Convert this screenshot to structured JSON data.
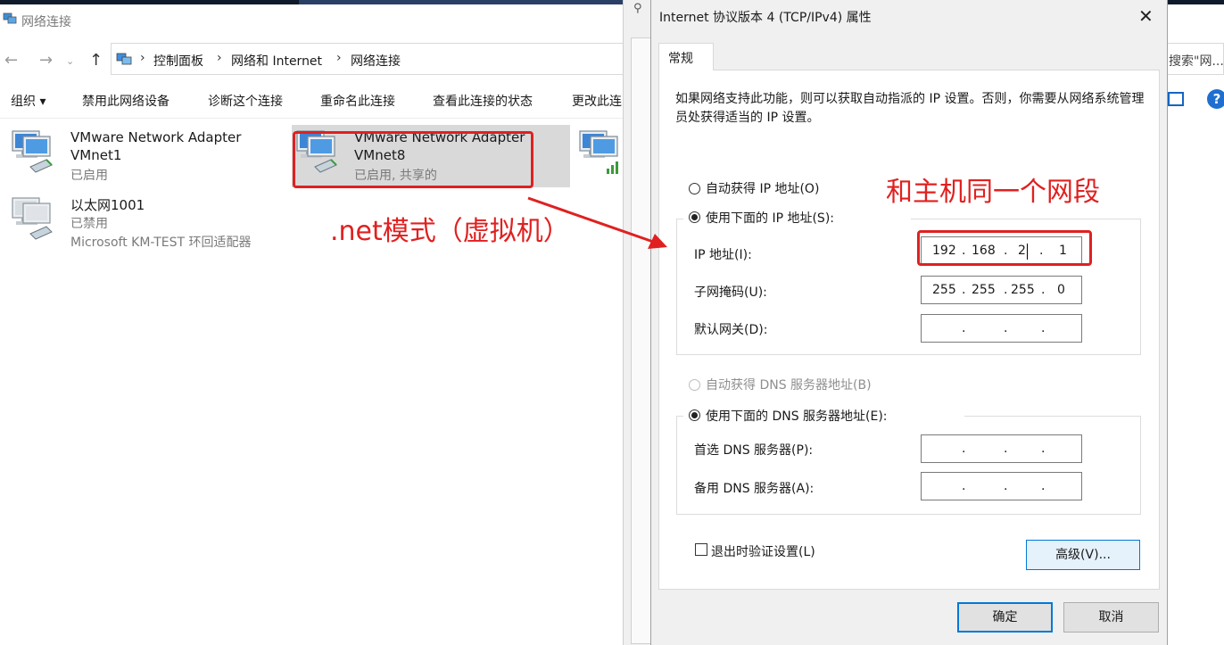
{
  "explorer": {
    "title": "网络连接",
    "breadcrumb": [
      "控制面板",
      "网络和 Internet",
      "网络连接"
    ],
    "search_placeholder": "搜索\"网...",
    "toolbar": [
      "组织 ▾",
      "禁用此网络设备",
      "诊断这个连接",
      "重命名此连接",
      "查看此连接的状态",
      "更改此连"
    ],
    "items": [
      {
        "name1": "VMware Network Adapter",
        "name2": "VMnet1",
        "status": "已启用"
      },
      {
        "name1": "VMware Network Adapter",
        "name2": "VMnet8",
        "status": "已启用, 共享的"
      },
      {
        "name1": "以太网1001",
        "status": "已禁用",
        "device": "Microsoft KM-TEST 环回适配器"
      }
    ]
  },
  "annotations": {
    "left": ".net模式（虚拟机）",
    "right": "和主机同一个网段"
  },
  "dialog": {
    "title": "Internet 协议版本 4 (TCP/IPv4) 属性",
    "tab": "常规",
    "description": "如果网络支持此功能，则可以获取自动指派的 IP 设置。否则，你需要从网络系统管理员处获得适当的 IP 设置。",
    "auto_ip": "自动获得 IP 地址(O)",
    "manual_ip": "使用下面的 IP 地址(S):",
    "ip_label": "IP 地址(I):",
    "ip": [
      "192",
      "168",
      "2",
      "1"
    ],
    "mask_label": "子网掩码(U):",
    "mask": [
      "255",
      "255",
      "255",
      "0"
    ],
    "gateway_label": "默认网关(D):",
    "auto_dns": "自动获得 DNS 服务器地址(B)",
    "manual_dns": "使用下面的 DNS 服务器地址(E):",
    "dns1_label": "首选 DNS 服务器(P):",
    "dns2_label": "备用 DNS 服务器(A):",
    "dot": ".",
    "validate": "退出时验证设置(L)",
    "advanced": "高级(V)...",
    "ok": "确定",
    "cancel": "取消"
  }
}
